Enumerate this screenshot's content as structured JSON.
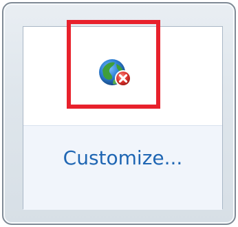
{
  "overflow_panel": {
    "customize_label": "Customize..."
  },
  "tray_icons": [
    {
      "icon": "network-disconnected-icon",
      "status": "disconnected"
    }
  ],
  "colors": {
    "highlight": "#e8212c",
    "link": "#1f66b3",
    "error_badge": "#d9302a"
  }
}
